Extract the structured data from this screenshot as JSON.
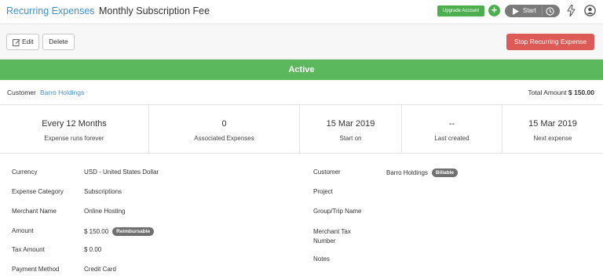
{
  "header": {
    "breadcrumb_link": "Recurring Expenses",
    "breadcrumb_separator": "›",
    "page_title": "Monthly Subscription Fee",
    "upgrade_label": "Upgrade Account",
    "plus_label": "+",
    "timer_start_label": "Start",
    "icons": [
      "play-icon",
      "clock-icon",
      "bolt-icon",
      "user-icon"
    ],
    "colors": {
      "link": "#3d8ed8",
      "green": "#4cae4f",
      "timer": "#7a7a7a"
    }
  },
  "toolbar": {
    "edit_label": "Edit",
    "delete_label": "Delete",
    "stop_label": "Stop Recurring Expense",
    "stop_color": "#de5a57"
  },
  "status": {
    "label": "Active",
    "color": "#5cb85c"
  },
  "customer_row": {
    "label": "Customer",
    "name": "Barro Holdings",
    "total_label": "Total Amount",
    "total_value": "$ 150.00"
  },
  "stats": [
    {
      "value": "Every 12 Months",
      "label": "Expense runs forever"
    },
    {
      "value": "0",
      "label": "Associated Expenses"
    },
    {
      "value": "15 Mar 2019",
      "label": "Start on"
    },
    {
      "value": "--",
      "label": "Last created"
    },
    {
      "value": "15 Mar 2019",
      "label": "Next expense"
    }
  ],
  "details_left": [
    {
      "label": "Currency",
      "value": "USD - United States Dollar"
    },
    {
      "label": "Expense Category",
      "value": "Subscriptions"
    },
    {
      "label": "Merchant Name",
      "value": "Online Hosting"
    },
    {
      "label": "Amount",
      "value": "$ 150.00",
      "badge": "Reimbursable"
    },
    {
      "label": "Tax Amount",
      "value": "$ 0.00"
    },
    {
      "label": "Payment Method",
      "value": "Credit Card"
    }
  ],
  "details_right": [
    {
      "label": "Customer",
      "value": "Barro Holdings",
      "badge": "Billable"
    },
    {
      "label": "Project",
      "value": ""
    },
    {
      "label": "Group/Trip Name",
      "value": ""
    },
    {
      "label": "Merchant Tax Number",
      "value": ""
    },
    {
      "label": "Notes",
      "value": ""
    }
  ]
}
